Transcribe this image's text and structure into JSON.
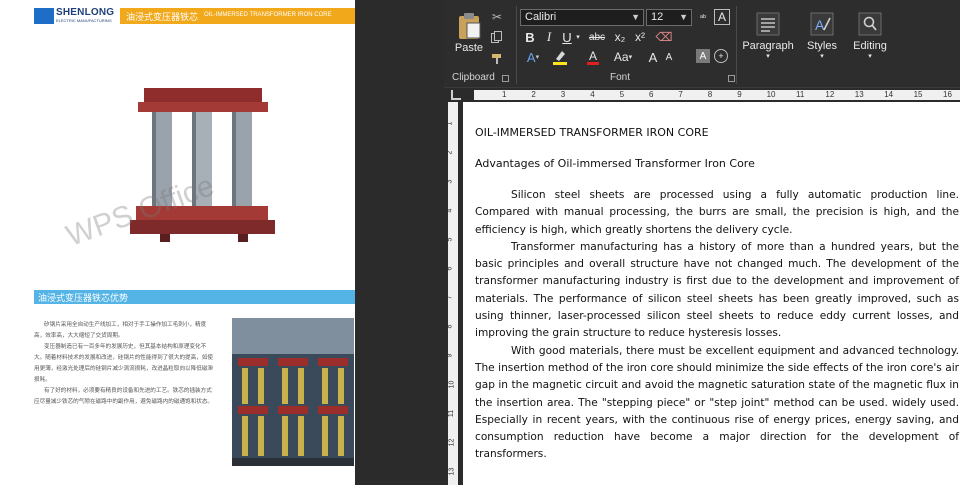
{
  "brochure": {
    "brand": "SHENLONG",
    "brand_sub": "ELECTRIC MANUFACTURING",
    "header_cn": "油浸式变压器铁芯",
    "header_en": "OIL-IMMERSED TRANSFORMER IRON CORE",
    "watermark": "WPS Office",
    "section_cn": "油浸式变压器铁芯优势",
    "paragraphs_cn": [
      "矽钢片采用全自动生产线加工，相对于手工操作加工毛刺小，精度高，效率高，大大缩短了交货周期。",
      "变压器制造已有一百多年的发展历史，但其基本结构和原理变化不大。随着材料技术的发展和改进，硅钢片的性能得到了很大的提高，如使用更薄，经激光处理后的硅钢片减少涡流损耗，改进晶粒取向以降低磁滞损耗。",
      "有了好的材料，必须要有精良的设备和先进的工艺。铁芯的插装方式应尽量减少铁芯的气隙在磁路中的副作用，避免磁路内的磁通饱和状态。"
    ]
  },
  "ribbon": {
    "clipboard": {
      "paste_label": "Paste",
      "group_label": "Clipboard"
    },
    "font": {
      "font_name": "Calibri",
      "font_size": "12",
      "group_label": "Font",
      "bold": "B",
      "italic": "I",
      "underline": "U",
      "strike": "abc",
      "subscript": "x₂",
      "superscript": "x²",
      "case": "Aa",
      "grow": "A",
      "shrink": "A"
    },
    "paragraph_label": "Paragraph",
    "styles_label": "Styles",
    "editing_label": "Editing"
  },
  "ruler": {
    "numbers": [
      "1",
      "2",
      "3",
      "4",
      "5",
      "6",
      "7",
      "8",
      "9",
      "10",
      "11",
      "12",
      "13",
      "14",
      "15",
      "16"
    ],
    "vnumbers": [
      "1",
      "2",
      "3",
      "4",
      "5",
      "6",
      "7",
      "8",
      "9",
      "10",
      "11",
      "12",
      "13"
    ]
  },
  "document": {
    "title": "OIL-IMMERSED TRANSFORMER IRON CORE",
    "subtitle": "Advantages of Oil-immersed Transformer Iron Core",
    "paragraphs": [
      "Silicon steel sheets are processed using a fully automatic production line. Compared with manual processing, the burrs are small, the precision is high, and the efficiency is high, which greatly shortens the delivery cycle.",
      "Transformer manufacturing has a history of more than a hundred years, but the basic principles and overall structure have not changed much. The development of the transformer manufacturing industry is first due to the development and improvement of materials. The performance of silicon steel sheets has been greatly improved, such as using thinner, laser-processed silicon steel sheets to reduce eddy current losses, and improving the grain structure to reduce hysteresis losses.",
      "With good materials, there must be excellent equipment and advanced technology. The insertion method of the iron core should minimize the side effects of the iron core's air gap in the magnetic circuit and avoid the magnetic saturation state of the magnetic flux in the insertion area. The \"stepping piece\" or \"step joint\" method can be used. widely used. Especially in recent years, with the continuous rise of energy prices, energy saving, and consumption reduction have become a major direction for the development of transformers."
    ]
  }
}
